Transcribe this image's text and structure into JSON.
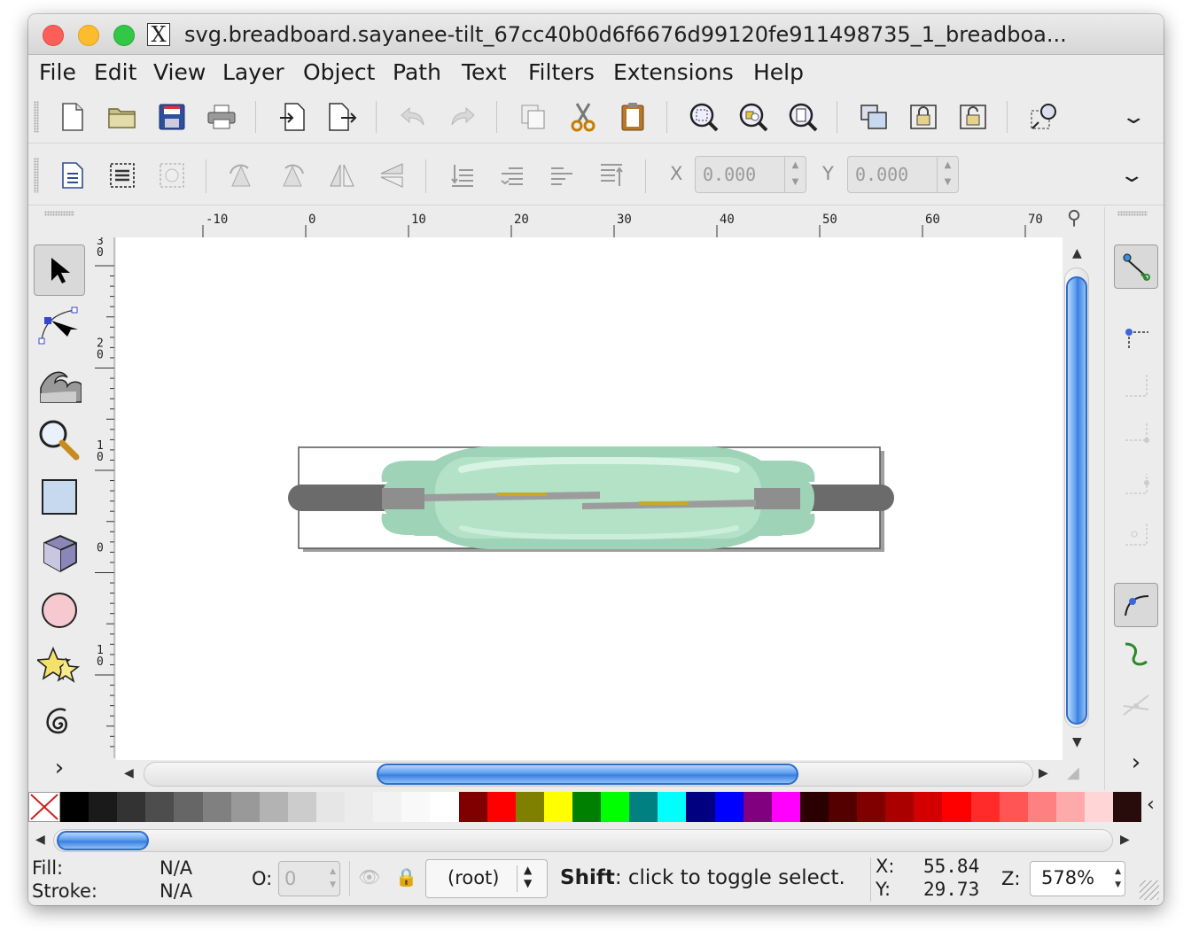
{
  "window": {
    "title": "svg.breadboard.sayanee-tilt_67cc40b0d6f6676d99120fe911498735_1_breadboa..."
  },
  "menu": [
    "File",
    "Edit",
    "View",
    "Layer",
    "Object",
    "Path",
    "Text",
    "Filters",
    "Extensions",
    "Help"
  ],
  "commands_toolbar": {
    "icons": [
      "new-document-icon",
      "open-folder-icon",
      "save-icon",
      "print-icon",
      "import-icon",
      "export-icon",
      "undo-icon",
      "redo-icon",
      "duplicate-icon",
      "cut-icon",
      "paste-icon",
      "zoom-selection-icon",
      "zoom-drawing-icon",
      "zoom-page-icon",
      "group-icon",
      "lock-icon",
      "unlock-icon",
      "node-editor-icon"
    ]
  },
  "select_toolbar": {
    "x_label": "X",
    "x_value": "0.000",
    "y_label": "Y",
    "y_value": "0.000"
  },
  "toolbox": {
    "tools": [
      "selector",
      "node-editor",
      "tweak",
      "zoom",
      "rectangle",
      "3d-box",
      "ellipse",
      "star",
      "spiral"
    ]
  },
  "ruler": {
    "h_labels": [
      "-10",
      "0",
      "10",
      "20",
      "30",
      "40",
      "50",
      "60",
      "70"
    ],
    "v_labels": [
      "30",
      "20",
      "10",
      "0",
      "10"
    ]
  },
  "palette": {
    "colors": [
      "#000000",
      "#1a1a1a",
      "#333333",
      "#4d4d4d",
      "#666666",
      "#808080",
      "#999999",
      "#b3b3b3",
      "#cccccc",
      "#e6e6e6",
      "#ececec",
      "#f2f2f2",
      "#f9f9f9",
      "#ffffff",
      "#800000",
      "#ff0000",
      "#808000",
      "#ffff00",
      "#008000",
      "#00ff00",
      "#008080",
      "#00ffff",
      "#000080",
      "#0000ff",
      "#800080",
      "#ff00ff",
      "#2b0000",
      "#550000",
      "#800000",
      "#aa0000",
      "#d40000",
      "#ff0000",
      "#ff2a2a",
      "#ff5555",
      "#ff8080",
      "#ffaaaa",
      "#ffd5d5",
      "#280b0b"
    ]
  },
  "status": {
    "fill_label": "Fill:",
    "fill_value": "N/A",
    "stroke_label": "Stroke:",
    "stroke_value": "N/A",
    "opacity_label": "O:",
    "opacity_value": "0",
    "layer": "(root)",
    "message_bold": "Shift",
    "message": ": click to toggle select.",
    "x_label": "X:",
    "x_value": "55.84",
    "y_label": "Y:",
    "y_value": "29.73",
    "zoom_label": "Z:",
    "zoom_value": "578%"
  },
  "accent_color": "#3a7fde"
}
